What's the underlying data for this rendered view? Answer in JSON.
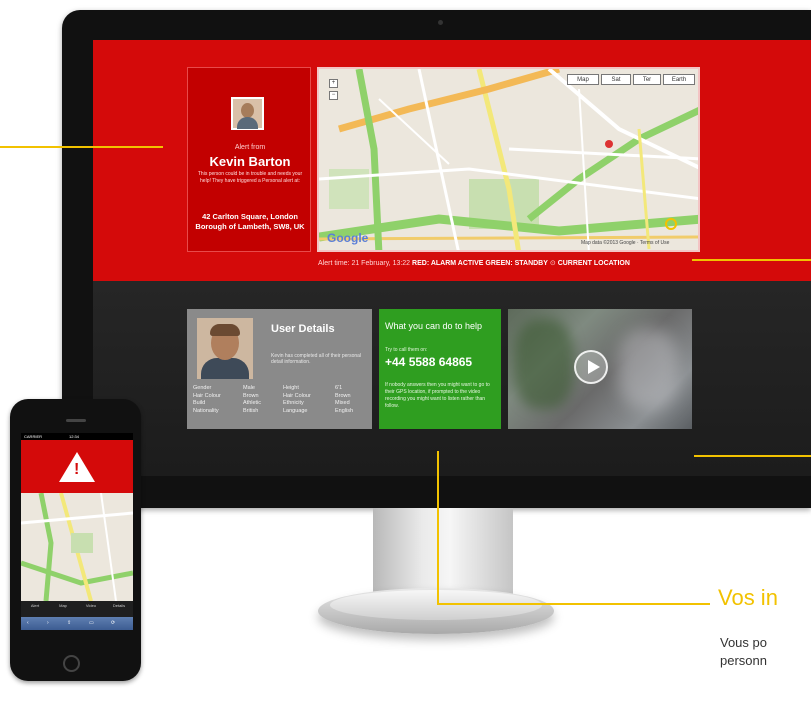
{
  "alert_card": {
    "from_label": "Alert from",
    "name": "Kevin Barton",
    "description": "This person could be in trouble and needs your help! They have triggered a Personal alert at:",
    "address": "42 Carlton Square, London Borough of Lambeth, SW8, UK"
  },
  "map": {
    "type_buttons": [
      "Map",
      "Sat",
      "Ter",
      "Earth"
    ],
    "zoom_buttons": [
      "+",
      "−"
    ],
    "logo": "Google",
    "terms": "Map data ©2013 Google · Terms of Use"
  },
  "status_bar": {
    "alert_time": "Alert time: 21 February, 13:22",
    "legend_red": "RED: ALARM ACTIVE",
    "legend_green": "GREEN: STANDBY",
    "legend_location": "CURRENT LOCATION"
  },
  "user_details": {
    "title": "User Details",
    "description": "Kevin has completed all of their personal detail information.",
    "columns": [
      [
        "Gender",
        "Hair Colour",
        "Build",
        "Nationality"
      ],
      [
        "Male",
        "Brown",
        "Athletic",
        "British"
      ],
      [
        "Height",
        "Hair Colour",
        "Ethnicity",
        "Language"
      ],
      [
        "6'1",
        "Brown",
        "Mixed",
        "English"
      ]
    ]
  },
  "help_card": {
    "title": "What you can do to help",
    "subtitle": "Try to call them on:",
    "phone": "+44 5588 64865",
    "description": "If nobody answers then you might want to go to their GPS location, if prompted to the video recording you might want to listen rather than follow."
  },
  "phone": {
    "carrier": "CARRIER",
    "time": "12:34",
    "tabs": [
      "Alert",
      "Map",
      "Video",
      "Details"
    ],
    "safari_items": [
      "‹",
      "›",
      "⇪",
      "▭",
      "⟳"
    ]
  },
  "callout": {
    "heading": "Vos in",
    "body_line1": "Vous po",
    "body_line2": "personn"
  },
  "colors": {
    "alert_red": "#d40a0a",
    "help_green": "#2f9e20",
    "callout_yellow": "#f2c200"
  }
}
